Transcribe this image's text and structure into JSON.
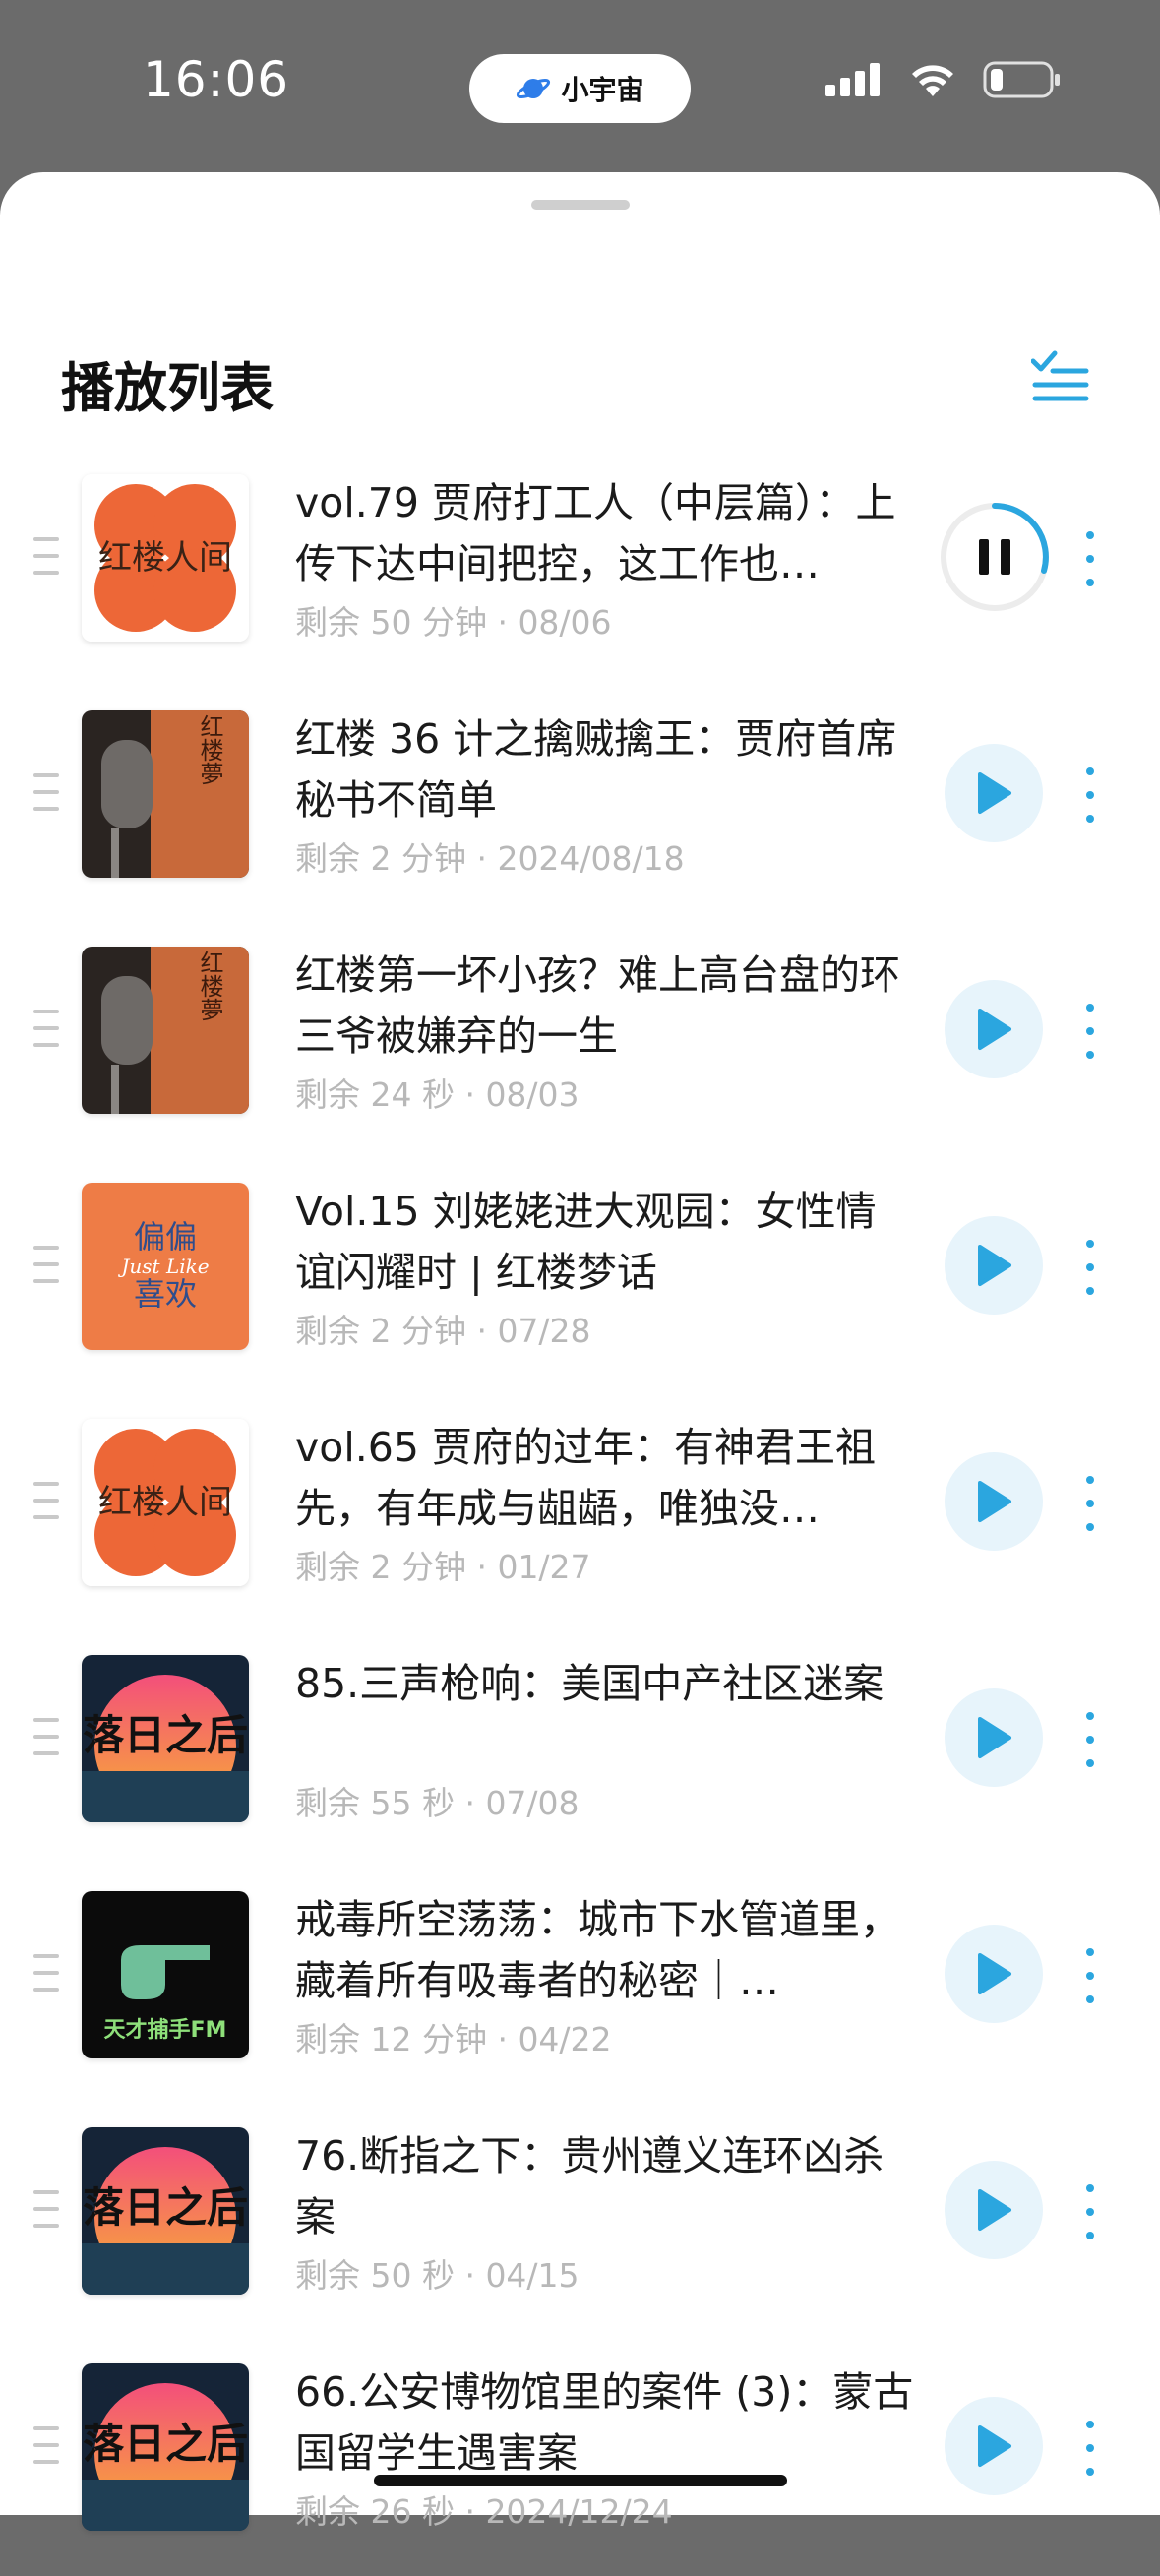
{
  "status_bar": {
    "time": "16:06",
    "island_label": "小宇宙"
  },
  "header": {
    "title": "播放列表"
  },
  "colors": {
    "accent": "#2ba6df",
    "play_bg": "#e7f4fb",
    "meta": "#b8b8b8"
  },
  "items": [
    {
      "title": "vol.79 贾府打工人（中层篇）：上传下达中间把控，这工作也…",
      "meta": "剩余 50 分钟 · 08/06",
      "cover": "honglou-renjian",
      "state": "playing"
    },
    {
      "title": "红楼 36 计之擒贼擒王：贾府首席秘书不简单",
      "meta": "剩余 2 分钟 · 2024/08/18",
      "cover": "honglou-meng-mic",
      "state": "paused"
    },
    {
      "title": "红楼第一坏小孩？难上高台盘的环三爷被嫌弃的一生",
      "meta": "剩余 24 秒 · 08/03",
      "cover": "honglou-meng-mic",
      "state": "paused"
    },
    {
      "title": "Vol.15 刘姥姥进大观园：女性情谊闪耀时 | 红楼梦话",
      "meta": "剩余 2 分钟 · 07/28",
      "cover": "pianpian-xihuan",
      "state": "paused"
    },
    {
      "title": "vol.65 贾府的过年：有神君王祖先，有年成与龃龉，唯独没…",
      "meta": "剩余 2 分钟 · 01/27",
      "cover": "honglou-renjian",
      "state": "paused"
    },
    {
      "title": "85.三声枪响：美国中产社区迷案",
      "meta": "剩余 55 秒 · 07/08",
      "cover": "luori-zhihou",
      "state": "paused"
    },
    {
      "title": "戒毒所空荡荡：城市下水管道里，藏着所有吸毒者的秘密｜…",
      "meta": "剩余 12 分钟 · 04/22",
      "cover": "tiancai-bushou",
      "state": "paused"
    },
    {
      "title": "76.断指之下：贵州遵义连环凶杀案",
      "meta": "剩余 50 秒 · 04/15",
      "cover": "luori-zhihou",
      "state": "paused"
    },
    {
      "title": "66.公安博物馆里的案件 (3)：蒙古国留学生遇害案",
      "meta": "剩余 26 秒 · 2024/12/24",
      "cover": "luori-zhihou",
      "state": "paused"
    }
  ],
  "cover_text": {
    "honglou_renjian": "红楼人间",
    "honglou_meng": "红楼夢",
    "pianpian_top": "偏偏",
    "pianpian_mid": "Just Like",
    "pianpian_bottom": "喜欢",
    "luori": "落日之后",
    "tiancai": "天才捕手FM"
  }
}
